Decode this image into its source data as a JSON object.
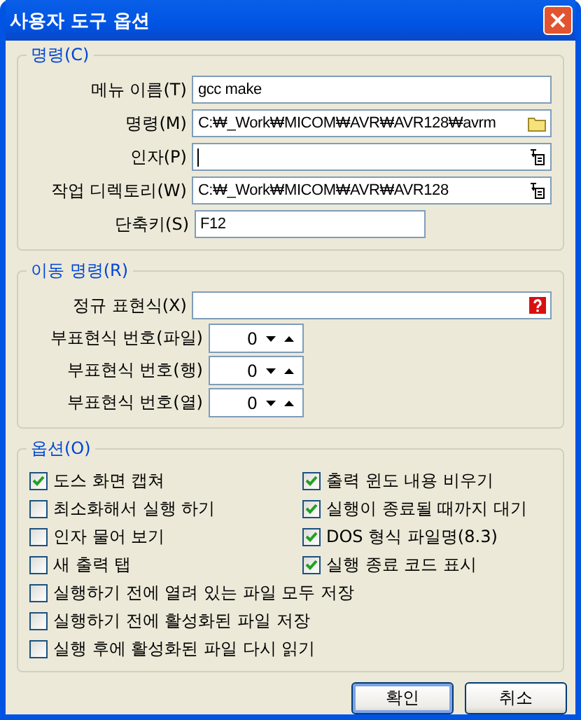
{
  "window": {
    "title": "사용자 도구 옵션"
  },
  "command_group": {
    "title": "명령(C)",
    "fields": [
      {
        "label": "메뉴 이름(T)",
        "value": "gcc make",
        "kind": "text",
        "focused": false
      },
      {
        "label": "명령(M)",
        "value": "C:₩_Work₩MICOM₩AVR₩AVR128₩avrm",
        "kind": "file",
        "focused": false
      },
      {
        "label": "인자(P)",
        "kind": "insert",
        "focused": true
      },
      {
        "label": "작업 디렉토리(W)",
        "value": "C:₩_Work₩MICOM₩AVR₩AVR128",
        "kind": "insert",
        "focused": false
      },
      {
        "label": "단축키(S)",
        "value": "F12",
        "kind": "shortcut",
        "focused": false
      }
    ]
  },
  "goto_group": {
    "title": "이동 명령(R)",
    "regex": {
      "label": "정규 표현식(X)",
      "kind": "help"
    },
    "spinners": [
      {
        "label": "부표현식 번호(파일)",
        "value": "0"
      },
      {
        "label": "부표현식 번호(행)",
        "value": "0"
      },
      {
        "label": "부표현식 번호(열)",
        "value": "0"
      }
    ]
  },
  "options_group": {
    "title": "옵션(O)",
    "left": [
      {
        "label": "도스 화면 캡쳐",
        "checked": true
      },
      {
        "label": "최소화해서 실행 하기",
        "checked": false
      },
      {
        "label": "인자 물어 보기",
        "checked": false
      },
      {
        "label": "새 출력 탭",
        "checked": false
      }
    ],
    "right": [
      {
        "label": "출력 윈도 내용 비우기",
        "checked": true
      },
      {
        "label": "실행이 종료될 때까지 대기",
        "checked": true
      },
      {
        "label": "DOS 형식 파일명(8.3)",
        "checked": true
      },
      {
        "label": "실행 종료 코드 표시",
        "checked": true
      }
    ],
    "full": [
      {
        "label": "실행하기 전에 열려 있는 파일 모두 저장",
        "checked": false
      },
      {
        "label": "실행하기 전에 활성화된 파일 저장",
        "checked": false
      },
      {
        "label": "실행 후에 활성화된 파일 다시 읽기",
        "checked": false
      }
    ]
  },
  "buttons": [
    {
      "label": "확인",
      "default": true
    },
    {
      "label": "취소",
      "default": false
    }
  ]
}
